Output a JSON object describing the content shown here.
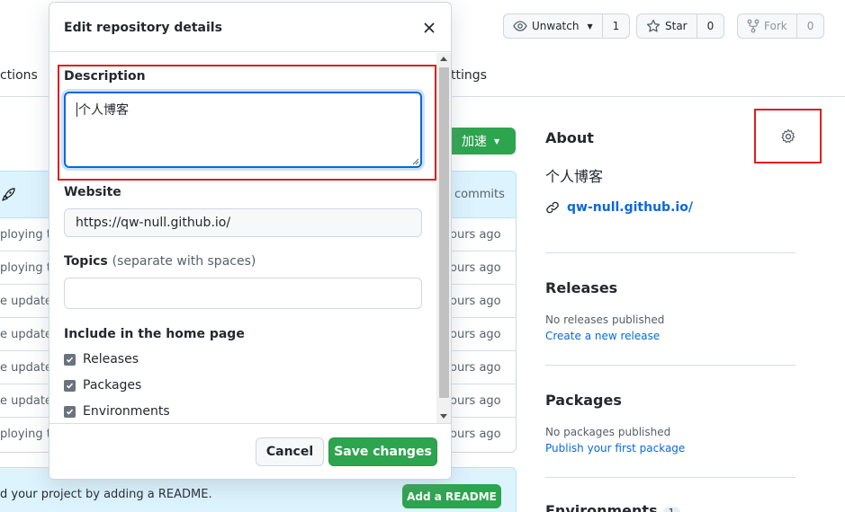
{
  "header_actions": {
    "unwatch_label": "Unwatch",
    "watch_count": "1",
    "star_label": "Star",
    "star_count": "0",
    "fork_label": "Fork",
    "fork_count": "0"
  },
  "tabs": {
    "left_partial": "ctions",
    "right_partial": "ttings"
  },
  "code_button_label": "加速",
  "commit_bar": {
    "commits_label": "commits"
  },
  "file_rows": [
    {
      "left": "ploying to",
      "right": "ours ago"
    },
    {
      "left": "ploying to",
      "right": "ours ago"
    },
    {
      "left": "e updated",
      "right": "ours ago"
    },
    {
      "left": "e updated",
      "right": "ours ago"
    },
    {
      "left": "e updated",
      "right": "ours ago"
    },
    {
      "left": "e updated",
      "right": "ours ago"
    },
    {
      "left": "ploying to",
      "right": "ours ago"
    }
  ],
  "readme": {
    "text": "d your project by adding a README.",
    "button_label": "Add a README"
  },
  "about": {
    "heading": "About",
    "description": "个人博客",
    "website": "qw-null.github.io/"
  },
  "releases": {
    "heading": "Releases",
    "empty_text": "No releases published",
    "create_link": "Create a new release"
  },
  "packages": {
    "heading": "Packages",
    "empty_text": "No packages published",
    "publish_link": "Publish your first package"
  },
  "environments": {
    "heading": "Environments",
    "count": "1"
  },
  "modal": {
    "title": "Edit repository details",
    "description_label": "Description",
    "description_value": "个人博客",
    "website_label": "Website",
    "website_value": "https://qw-null.github.io/",
    "topics_label": "Topics",
    "topics_hint": "(separate with spaces)",
    "topics_value": "",
    "include_label": "Include in the home page",
    "checkboxes": [
      {
        "label": "Releases",
        "checked": true
      },
      {
        "label": "Packages",
        "checked": true
      },
      {
        "label": "Environments",
        "checked": true
      }
    ],
    "cancel_label": "Cancel",
    "save_label": "Save changes"
  },
  "colors": {
    "primary_green": "#2da44e",
    "link_blue": "#0969da",
    "highlight_red": "#e01e1e"
  }
}
